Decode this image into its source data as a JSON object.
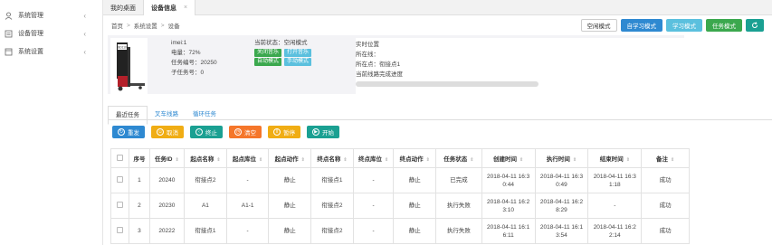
{
  "sidebar": {
    "items": [
      {
        "label": "系统管理",
        "icon": "user-icon"
      },
      {
        "label": "设备管理",
        "icon": "device-icon"
      },
      {
        "label": "系统设置",
        "icon": "settings-icon"
      }
    ]
  },
  "tabs": [
    {
      "label": "我的桌面"
    },
    {
      "label": "设备信息",
      "close": "×"
    }
  ],
  "breadcrumb": {
    "home": "首页",
    "level1": "系统设置",
    "level2": "设备",
    "sep": ">"
  },
  "mode_buttons": {
    "idle": "空闲模式",
    "self_learn": "自学习模式",
    "learn": "学习模式",
    "task": "任务模式",
    "refresh_icon": "refresh-icon"
  },
  "device": {
    "robot_label": "BD110",
    "imei": "imei:1",
    "battery": "电量：72%",
    "task_no": "任务编号：20250",
    "subtask_no": "子任务号：0",
    "current_state": "当前状态：空闲模式",
    "btn_music_off": "关闭音乐",
    "btn_music_on": "打开音乐",
    "btn_auto": "自动模式",
    "btn_manual": "手动模式",
    "realtime_pos": "实时位置",
    "line": "所在线：",
    "point": "所在点：衔接点1",
    "line_progress_label": "当前线路完成进度",
    "line_progress": 0
  },
  "subtabs": [
    "最近任务",
    "叉车线路",
    "循环任务"
  ],
  "actions": [
    {
      "label": "重发",
      "color": "blue"
    },
    {
      "label": "取消",
      "color": "yellow"
    },
    {
      "label": "终止",
      "color": "teal"
    },
    {
      "label": "清空",
      "color": "orange"
    },
    {
      "label": "暂停",
      "color": "yellow"
    },
    {
      "label": "开始",
      "color": "teal"
    }
  ],
  "table": {
    "headers": [
      "序号",
      "任务ID",
      "起点名称",
      "起点库位",
      "起点动作",
      "终点名称",
      "终点库位",
      "终点动作",
      "任务状态",
      "创建时间",
      "执行时间",
      "结束时间",
      "备注"
    ],
    "rows": [
      [
        "1",
        "20240",
        "衔接点2",
        "-",
        "静止",
        "衔接点1",
        "-",
        "静止",
        "已完成",
        "2018-04-11 16:3\n0:44",
        "2018-04-11 16:3\n0:49",
        "2018-04-11 16:3\n1:18",
        "成功"
      ],
      [
        "2",
        "20230",
        "A1",
        "A1-1",
        "静止",
        "衔接点2",
        "-",
        "静止",
        "执行失败",
        "2018-04-11 16:2\n3:10",
        "2018-04-11 16:2\n8:29",
        "-",
        "成功"
      ],
      [
        "3",
        "20222",
        "衔接点1",
        "-",
        "静止",
        "衔接点2",
        "-",
        "静止",
        "执行失败",
        "2018-04-11 16:1\n6:11",
        "2018-04-11 16:1\n3:54",
        "2018-04-11 16:2\n2:14",
        "成功"
      ]
    ]
  }
}
